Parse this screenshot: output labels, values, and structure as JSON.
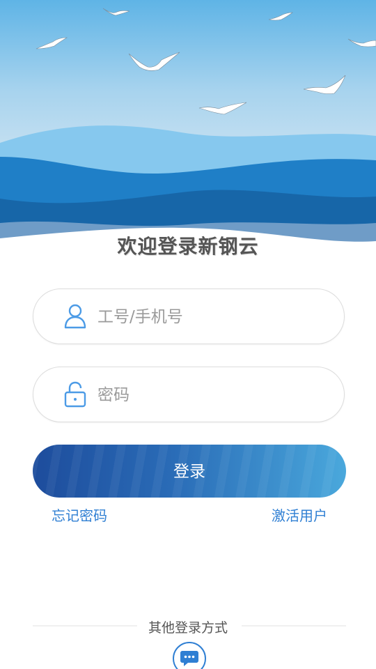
{
  "header": {
    "welcome_title": "欢迎登录新钢云"
  },
  "form": {
    "username_placeholder": "工号/手机号",
    "username_value": "",
    "password_placeholder": "密码",
    "password_value": "",
    "login_label": "登录",
    "forgot_password_label": "忘记密码",
    "activate_user_label": "激活用户"
  },
  "other_login": {
    "label": "其他登录方式",
    "icons": [
      "chat-bubble-icon"
    ]
  },
  "icons": {
    "username": "person-icon",
    "password": "lock-icon"
  },
  "colors": {
    "accent": "#2f7fd3",
    "button_start": "#1d4c9c",
    "button_end": "#4aa8dc",
    "sea_dark": "#1f73b8",
    "sky": "#cfe3f1"
  }
}
